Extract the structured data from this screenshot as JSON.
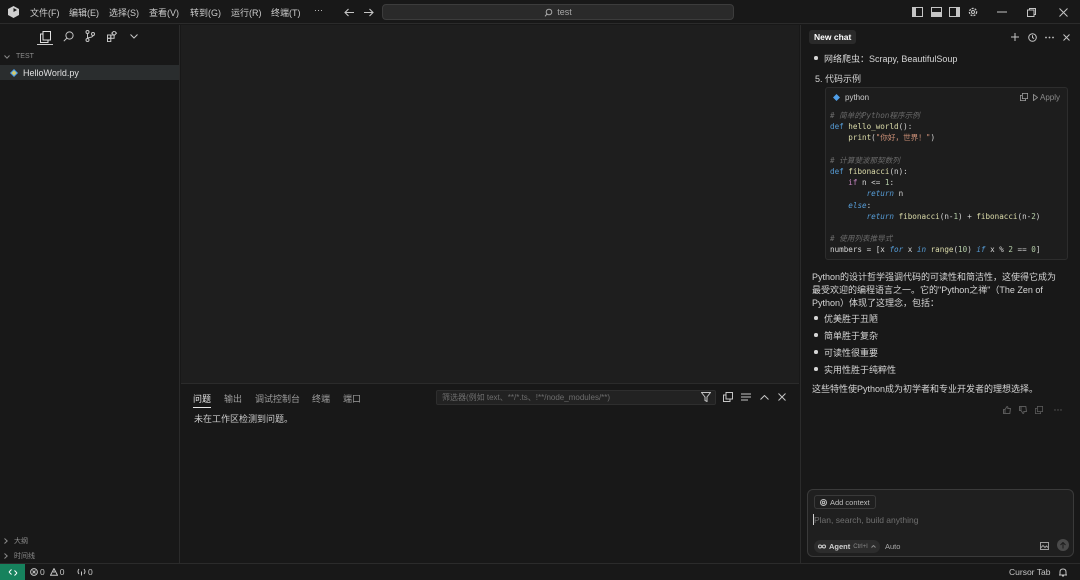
{
  "menu": {
    "file": "文件(F)",
    "edit": "编辑(E)",
    "selection": "选择(S)",
    "view": "查看(V)",
    "goto": "转到(G)",
    "run": "运行(R)",
    "terminal": "终端(T)",
    "more": "···"
  },
  "search": {
    "text": "test"
  },
  "sidebar": {
    "section_title": "TEST",
    "files": [
      "HelloWorld.py"
    ],
    "outline": "大纲",
    "timeline": "时间线"
  },
  "panel": {
    "tabs": [
      "问题",
      "输出",
      "调试控制台",
      "终端",
      "端口"
    ],
    "filter_placeholder": "筛选器(例如 text、**/*.ts、!**/node_modules/**)",
    "message": "未在工作区检测到问题。"
  },
  "chat": {
    "tab_title": "New chat",
    "top_bullet": "网络爬虫：Scrapy, BeautifulSoup",
    "numbered_item": "5. 代码示例",
    "code_lang": "python",
    "apply_label": "Apply",
    "para1_line1": "Python的设计哲学强调代码的可读性和简洁性，这使得它成为",
    "para1_line2": "最受欢迎的编程语言之一。它的\"Python之禅\"（The Zen of",
    "para1_line3": "Python）体现了这理念，包括：",
    "bullets": [
      "优美胜于丑陋",
      "简单胜于复杂",
      "可读性很重要",
      "实用性胜于纯粹性"
    ],
    "para2": "这些特性使Python成为初学者和专业开发者的理想选择。",
    "add_context": "Add context",
    "input_placeholder": "Plan, search, build anything",
    "mode": "Agent",
    "mode_shortcut": "Ctrl+I",
    "model": "Auto"
  },
  "status": {
    "errors": "0",
    "warnings": "0",
    "ports": "0",
    "cursor_tab": "Cursor Tab"
  },
  "colors": {
    "background": "#181818",
    "editor": "#1e1e1e",
    "remote_indicator": "#16825d",
    "python_icon": "#4f9ee8"
  },
  "icons": [
    "cursor-logo-icon",
    "back-icon",
    "forward-icon",
    "search-icon",
    "layout-icons",
    "settings-icon",
    "explorer-icon",
    "git-icon",
    "extensions-icon",
    "filter-icon",
    "copy-icon",
    "plus-icon",
    "history-icon",
    "close-icon",
    "image-icon",
    "send-icon",
    "bell-icon"
  ]
}
